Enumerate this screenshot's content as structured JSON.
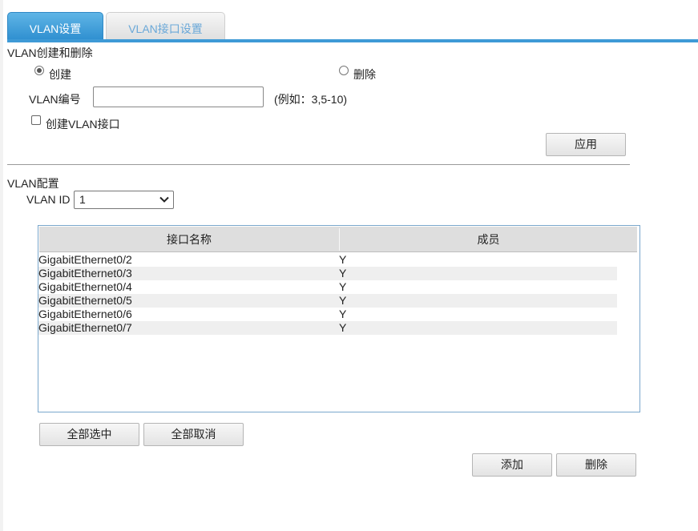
{
  "tabs": [
    {
      "label": "VLAN设置",
      "active": true
    },
    {
      "label": "VLAN接口设置",
      "active": false
    }
  ],
  "create_delete": {
    "title": "VLAN创建和删除",
    "radio_create": "创建",
    "radio_delete": "删除",
    "selected": "create",
    "vlan_id_label": "VLAN编号",
    "vlan_id_value": "",
    "example_hint": "(例如：3,5-10)",
    "create_interface_label": "创建VLAN接口",
    "create_interface_checked": false,
    "apply_button": "应用"
  },
  "vlan_config": {
    "title": "VLAN配置",
    "vlan_id_label": "VLAN ID",
    "vlan_id_selected": "1"
  },
  "table": {
    "headers": [
      "接口名称",
      "成员"
    ],
    "rows": [
      {
        "name": "GigabitEthernet0/2",
        "member": "Y"
      },
      {
        "name": "GigabitEthernet0/3",
        "member": "Y"
      },
      {
        "name": "GigabitEthernet0/4",
        "member": "Y"
      },
      {
        "name": "GigabitEthernet0/5",
        "member": "Y"
      },
      {
        "name": "GigabitEthernet0/6",
        "member": "Y"
      },
      {
        "name": "GigabitEthernet0/7",
        "member": "Y"
      }
    ]
  },
  "buttons": {
    "select_all": "全部选中",
    "deselect_all": "全部取消",
    "add": "添加",
    "delete": "删除"
  },
  "colors": {
    "accent": "#3e9ad6",
    "tab_active": "#2f8fd0",
    "row_alt": "#efefef"
  }
}
